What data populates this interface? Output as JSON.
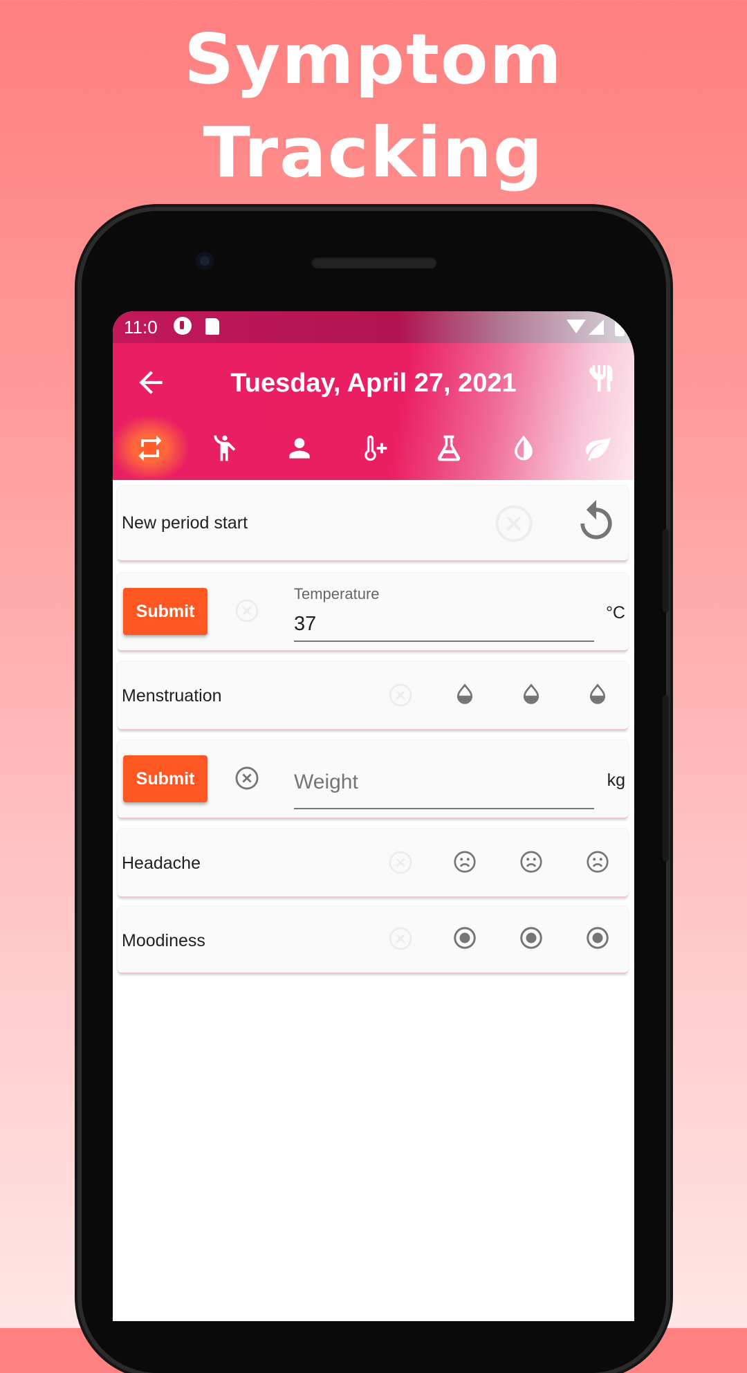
{
  "headline": {
    "line1": "Symptom",
    "line2": "Tracking"
  },
  "status_bar": {
    "time": "11:0"
  },
  "app_bar": {
    "title": "Tuesday, April 27, 2021"
  },
  "tabs": [
    {
      "icon": "repeat-icon",
      "active": true
    },
    {
      "icon": "accessibility-icon",
      "active": false
    },
    {
      "icon": "person-icon",
      "active": false
    },
    {
      "icon": "thermometer-plus-icon",
      "active": false
    },
    {
      "icon": "flask-icon",
      "active": false
    },
    {
      "icon": "drop-half-icon",
      "active": false
    },
    {
      "icon": "leaf-icon",
      "active": false
    }
  ],
  "rows": {
    "period": {
      "label": "New period start"
    },
    "temperature": {
      "submit_label": "Submit",
      "field_label": "Temperature",
      "value": "37",
      "unit": "°C"
    },
    "menstruation": {
      "label": "Menstruation"
    },
    "weight": {
      "submit_label": "Submit",
      "placeholder": "Weight",
      "value": "",
      "unit": "kg"
    },
    "headache": {
      "label": "Headache"
    },
    "moodiness": {
      "label": "Moodiness"
    }
  },
  "colors": {
    "primary": "#e91e63",
    "accent": "#ff5722",
    "status_bar": "#c2185b",
    "icon_gray": "#757575"
  }
}
